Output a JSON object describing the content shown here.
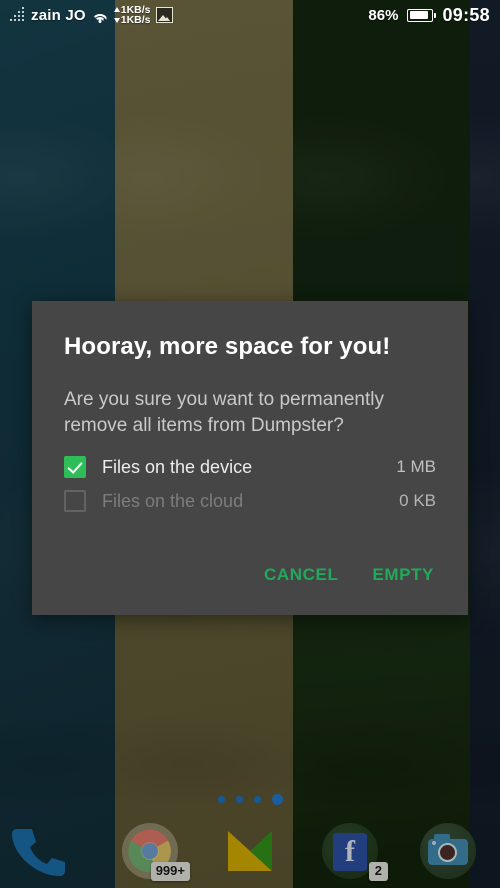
{
  "status_bar": {
    "signal_icon": "signal-dots-icon",
    "carrier": "zain JO",
    "wifi_icon": "wifi-icon",
    "upload_speed": "1KB/s",
    "download_speed": "1KB/s",
    "notification_icon": "gallery-image-icon",
    "battery_percent": "86%",
    "battery_icon": "battery-icon",
    "clock": "09:58"
  },
  "dialog": {
    "title": "Hooray, more space for you!",
    "message": "Are you sure you want to permanently remove all items from Dumpster?",
    "options": [
      {
        "label": "Files on the device",
        "size": "1 MB",
        "checked": true,
        "enabled": true
      },
      {
        "label": "Files on the cloud",
        "size": "0 KB",
        "checked": false,
        "enabled": false
      }
    ],
    "cancel_label": "CANCEL",
    "confirm_label": "EMPTY",
    "accent_color": "#22a85a",
    "checkbox_color": "#2ebd59",
    "background_color": "#464646"
  },
  "home_screen": {
    "page_dots": {
      "count": 4,
      "active_index": 3,
      "color": "#1b6ec2"
    },
    "dock": [
      {
        "name": "phone",
        "badge": null
      },
      {
        "name": "chrome",
        "badge": "999+"
      },
      {
        "name": "gmail",
        "badge": null
      },
      {
        "name": "facebook",
        "badge": "2"
      },
      {
        "name": "camera",
        "badge": null
      }
    ]
  },
  "wallpaper": {
    "bands": [
      "#14384a",
      "#645d3b",
      "#142511",
      "#131e2b"
    ]
  }
}
